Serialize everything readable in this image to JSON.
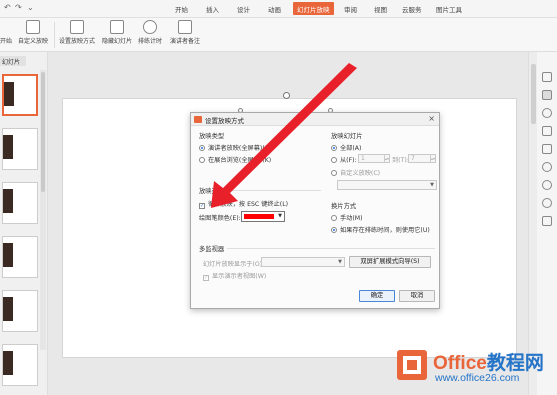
{
  "ribbon_tabs": [
    "开始",
    "插入",
    "设计",
    "动画",
    "幻灯片放映",
    "审阅",
    "视图",
    "云服务",
    "图片工具"
  ],
  "active_tab": "幻灯片放映",
  "toolbar": {
    "partial_left": "开始",
    "custom_show": "自定义放映",
    "setup_show": "设置放映方式",
    "hide_slide": "隐藏幻灯片",
    "rehearse": "排练计时",
    "presenter_notes": "演讲者备注"
  },
  "left_panel": {
    "tab_label": "幻灯片"
  },
  "dialog": {
    "title": "设置放映方式",
    "show_type": {
      "label": "放映类型",
      "options": [
        "演讲者放映(全屏幕)(P)",
        "在展台浏览(全屏幕)(K)"
      ],
      "selected": 0
    },
    "show_options": {
      "label": "放映选项",
      "loop_label": "循环放映，按 ESC 键终止(L)",
      "loop_checked": true,
      "pen_color_label": "绘图笔颜色(E):",
      "pen_color": "#ff0000"
    },
    "show_slides": {
      "label": "放映幻灯片",
      "all_label": "全部(A)",
      "from_label": "从(F):",
      "from_value": "1",
      "to_label": "到(T):",
      "to_value": "7",
      "custom_label": "自定义放映(C)"
    },
    "advance": {
      "label": "换片方式",
      "manual_label": "手动(M)",
      "timing_label": "如果存在排练时间，则使用它(U)",
      "selected": 1
    },
    "multi_monitor": {
      "label": "多监视器",
      "display_on_label": "幻灯片放映显示于(O):",
      "ext_button": "双屏扩展模式向导(S)",
      "presenter_view_label": "显示演示者视图(W)"
    },
    "ok_label": "确定",
    "cancel_label": "取消"
  },
  "watermark": {
    "brand_a": "Office",
    "brand_b": "教程网",
    "url": "www.office26.com"
  },
  "colors": {
    "accent": "#e9653a",
    "arrow": "#e8202a",
    "brand_blue": "#2574c8"
  },
  "icons": [
    "undo-icon",
    "redo-icon",
    "dropdown-icon",
    "play-icon",
    "clock-icon",
    "close-icon",
    "shield-icon"
  ]
}
